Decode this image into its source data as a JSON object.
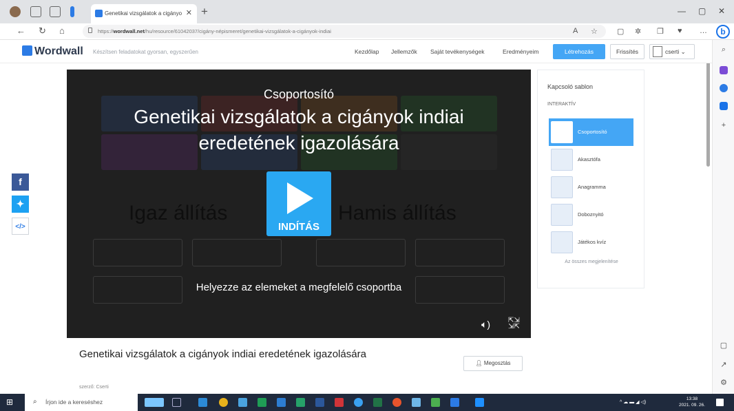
{
  "browser": {
    "tab_title": "Genetikai vizsgálatok a cigányo",
    "url_prefix": "https://",
    "url_domain": "wordwall.net",
    "url_path": "/hu/resource/61042037/cigány-népismeret/genetikai-vizsgálatok-a-cigányok-indiai"
  },
  "site": {
    "logo": "Wordwall",
    "tagline": "Készítsen feladatokat gyorsan, egyszerűen",
    "menu": [
      "Kezdőlap",
      "Jellemzők",
      "Saját tevékenységek",
      "Eredményeim"
    ],
    "create_label": "Létrehozás",
    "upgrade_label": "Frissítés",
    "user_name": "cserti"
  },
  "player": {
    "activity_type": "Csoportosító",
    "title": "Genetikai vizsgálatok a cigányok indiai eredetének igazolására",
    "start_label": "INDÍTÁS",
    "instruction": "Helyezze az elemeket a megfelelő csoportba",
    "group_true": "Igaz állítás",
    "group_false": "Hamis állítás"
  },
  "below": {
    "title": "Genetikai vizsgálatok a cigányok indiai eredetének igazolására",
    "byline": "szerző: Cserti",
    "share_label": "Megosztás"
  },
  "switcher": {
    "title": "Kapcsoló sablon",
    "subtitle": "INTERAKTÍV",
    "templates": [
      {
        "name": "Csoportosító",
        "active": true
      },
      {
        "name": "Akasztófa",
        "active": false
      },
      {
        "name": "Anagramma",
        "active": false
      },
      {
        "name": "Doboznyitó",
        "active": false
      },
      {
        "name": "Játékos kvíz",
        "active": false
      }
    ],
    "show_all": "Az összes megjelenítése"
  },
  "taskbar": {
    "search_placeholder": "Írjon ide a kereséshez",
    "time": "13:38",
    "date": "2021. 09. 26."
  },
  "colors": {
    "accent": "#44a6f5",
    "play": "#2aa8f2",
    "player_bg": "#202020",
    "facebook": "#3b5998",
    "twitter": "#1da1f2",
    "taskbar": "#1f2a3d"
  },
  "icons": [
    "close-icon",
    "back-icon",
    "refresh-icon",
    "home-icon",
    "lock-icon",
    "star-icon",
    "bing-icon",
    "play-icon",
    "sound-icon",
    "fullscreen-icon",
    "facebook-icon",
    "twitter-icon",
    "embed-icon",
    "user-icon",
    "search-icon",
    "windows-icon"
  ]
}
